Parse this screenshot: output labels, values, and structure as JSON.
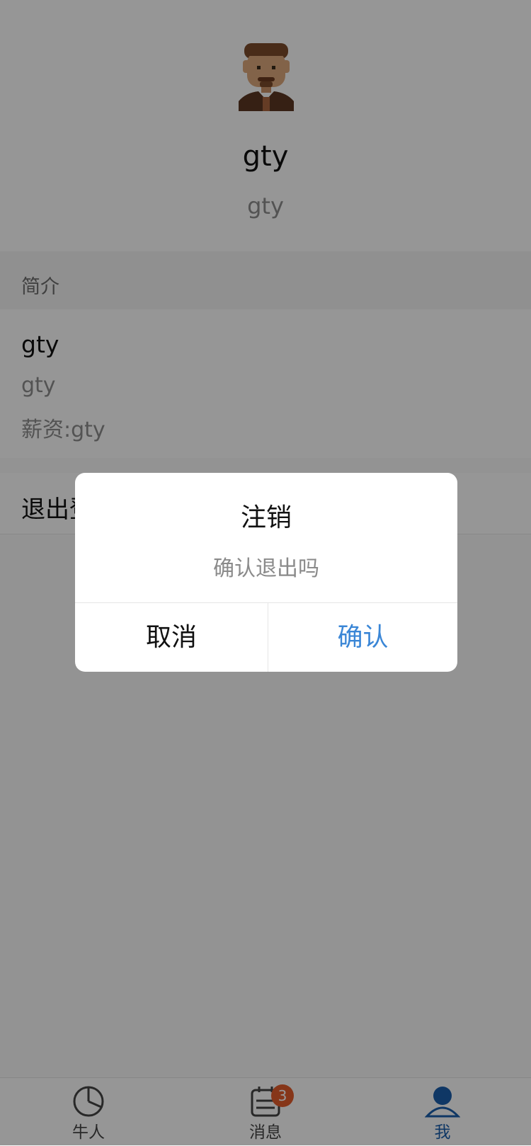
{
  "profile": {
    "display_name": "gty",
    "username": "gty"
  },
  "intro_section": {
    "title": "简介",
    "name": "gty",
    "description": "gty",
    "salary": "薪资:gty"
  },
  "logout": {
    "label": "退出登录"
  },
  "dialog": {
    "title": "注销",
    "message": "确认退出吗",
    "cancel_label": "取消",
    "confirm_label": "确认"
  },
  "tabbar": {
    "items": [
      {
        "label": "牛人",
        "icon": "pie-chart-icon"
      },
      {
        "label": "消息",
        "icon": "calendar-list-icon",
        "badge": "3"
      },
      {
        "label": "我",
        "icon": "user-icon",
        "active": true
      }
    ]
  },
  "colors": {
    "accent": "#3a86d6",
    "active_tab": "#1a5ca8",
    "badge": "#e05a2b"
  }
}
